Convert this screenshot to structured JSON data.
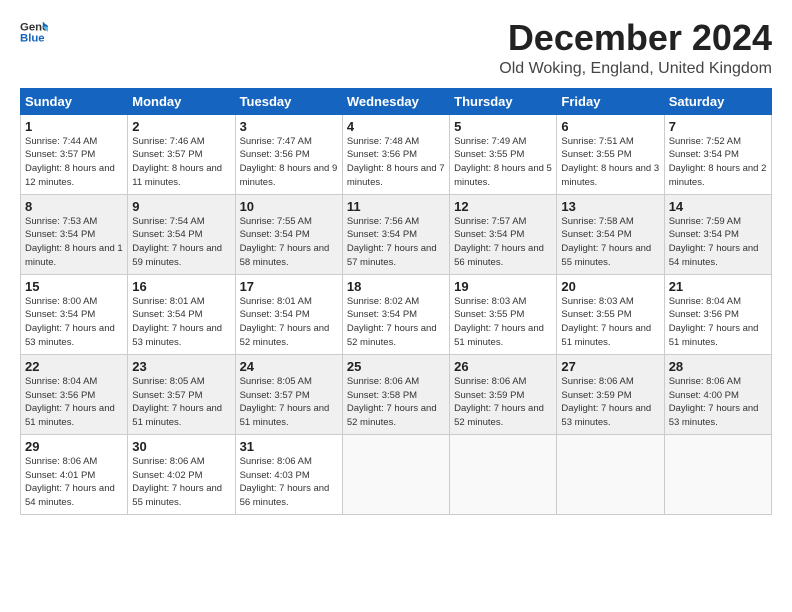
{
  "header": {
    "logo_line1": "General",
    "logo_line2": "Blue",
    "month": "December 2024",
    "location": "Old Woking, England, United Kingdom"
  },
  "days_of_week": [
    "Sunday",
    "Monday",
    "Tuesday",
    "Wednesday",
    "Thursday",
    "Friday",
    "Saturday"
  ],
  "weeks": [
    [
      {
        "day": 1,
        "sunrise": "7:44 AM",
        "sunset": "3:57 PM",
        "daylight": "8 hours and 12 minutes."
      },
      {
        "day": 2,
        "sunrise": "7:46 AM",
        "sunset": "3:57 PM",
        "daylight": "8 hours and 11 minutes."
      },
      {
        "day": 3,
        "sunrise": "7:47 AM",
        "sunset": "3:56 PM",
        "daylight": "8 hours and 9 minutes."
      },
      {
        "day": 4,
        "sunrise": "7:48 AM",
        "sunset": "3:56 PM",
        "daylight": "8 hours and 7 minutes."
      },
      {
        "day": 5,
        "sunrise": "7:49 AM",
        "sunset": "3:55 PM",
        "daylight": "8 hours and 5 minutes."
      },
      {
        "day": 6,
        "sunrise": "7:51 AM",
        "sunset": "3:55 PM",
        "daylight": "8 hours and 3 minutes."
      },
      {
        "day": 7,
        "sunrise": "7:52 AM",
        "sunset": "3:54 PM",
        "daylight": "8 hours and 2 minutes."
      }
    ],
    [
      {
        "day": 8,
        "sunrise": "7:53 AM",
        "sunset": "3:54 PM",
        "daylight": "8 hours and 1 minute."
      },
      {
        "day": 9,
        "sunrise": "7:54 AM",
        "sunset": "3:54 PM",
        "daylight": "7 hours and 59 minutes."
      },
      {
        "day": 10,
        "sunrise": "7:55 AM",
        "sunset": "3:54 PM",
        "daylight": "7 hours and 58 minutes."
      },
      {
        "day": 11,
        "sunrise": "7:56 AM",
        "sunset": "3:54 PM",
        "daylight": "7 hours and 57 minutes."
      },
      {
        "day": 12,
        "sunrise": "7:57 AM",
        "sunset": "3:54 PM",
        "daylight": "7 hours and 56 minutes."
      },
      {
        "day": 13,
        "sunrise": "7:58 AM",
        "sunset": "3:54 PM",
        "daylight": "7 hours and 55 minutes."
      },
      {
        "day": 14,
        "sunrise": "7:59 AM",
        "sunset": "3:54 PM",
        "daylight": "7 hours and 54 minutes."
      }
    ],
    [
      {
        "day": 15,
        "sunrise": "8:00 AM",
        "sunset": "3:54 PM",
        "daylight": "7 hours and 53 minutes."
      },
      {
        "day": 16,
        "sunrise": "8:01 AM",
        "sunset": "3:54 PM",
        "daylight": "7 hours and 53 minutes."
      },
      {
        "day": 17,
        "sunrise": "8:01 AM",
        "sunset": "3:54 PM",
        "daylight": "7 hours and 52 minutes."
      },
      {
        "day": 18,
        "sunrise": "8:02 AM",
        "sunset": "3:54 PM",
        "daylight": "7 hours and 52 minutes."
      },
      {
        "day": 19,
        "sunrise": "8:03 AM",
        "sunset": "3:55 PM",
        "daylight": "7 hours and 51 minutes."
      },
      {
        "day": 20,
        "sunrise": "8:03 AM",
        "sunset": "3:55 PM",
        "daylight": "7 hours and 51 minutes."
      },
      {
        "day": 21,
        "sunrise": "8:04 AM",
        "sunset": "3:56 PM",
        "daylight": "7 hours and 51 minutes."
      }
    ],
    [
      {
        "day": 22,
        "sunrise": "8:04 AM",
        "sunset": "3:56 PM",
        "daylight": "7 hours and 51 minutes."
      },
      {
        "day": 23,
        "sunrise": "8:05 AM",
        "sunset": "3:57 PM",
        "daylight": "7 hours and 51 minutes."
      },
      {
        "day": 24,
        "sunrise": "8:05 AM",
        "sunset": "3:57 PM",
        "daylight": "7 hours and 51 minutes."
      },
      {
        "day": 25,
        "sunrise": "8:06 AM",
        "sunset": "3:58 PM",
        "daylight": "7 hours and 52 minutes."
      },
      {
        "day": 26,
        "sunrise": "8:06 AM",
        "sunset": "3:59 PM",
        "daylight": "7 hours and 52 minutes."
      },
      {
        "day": 27,
        "sunrise": "8:06 AM",
        "sunset": "3:59 PM",
        "daylight": "7 hours and 53 minutes."
      },
      {
        "day": 28,
        "sunrise": "8:06 AM",
        "sunset": "4:00 PM",
        "daylight": "7 hours and 53 minutes."
      }
    ],
    [
      {
        "day": 29,
        "sunrise": "8:06 AM",
        "sunset": "4:01 PM",
        "daylight": "7 hours and 54 minutes."
      },
      {
        "day": 30,
        "sunrise": "8:06 AM",
        "sunset": "4:02 PM",
        "daylight": "7 hours and 55 minutes."
      },
      {
        "day": 31,
        "sunrise": "8:06 AM",
        "sunset": "4:03 PM",
        "daylight": "7 hours and 56 minutes."
      },
      null,
      null,
      null,
      null
    ]
  ]
}
